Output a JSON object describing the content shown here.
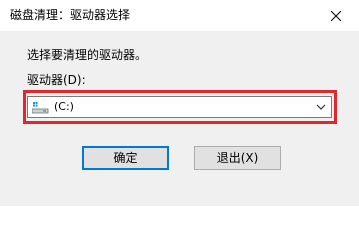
{
  "window": {
    "title": "磁盘清理：驱动器选择"
  },
  "dialog": {
    "instruction": "选择要清理的驱动器。",
    "drive_label": "驱动器(D):",
    "drive_select": {
      "selected_value": "(C:)",
      "icon": "hard-drive-icon"
    },
    "highlight_color": "#e2262c"
  },
  "buttons": {
    "ok_label": "确定",
    "cancel_label": "退出(X)"
  },
  "colors": {
    "accent": "#0078d7",
    "highlight": "#e2262c"
  }
}
